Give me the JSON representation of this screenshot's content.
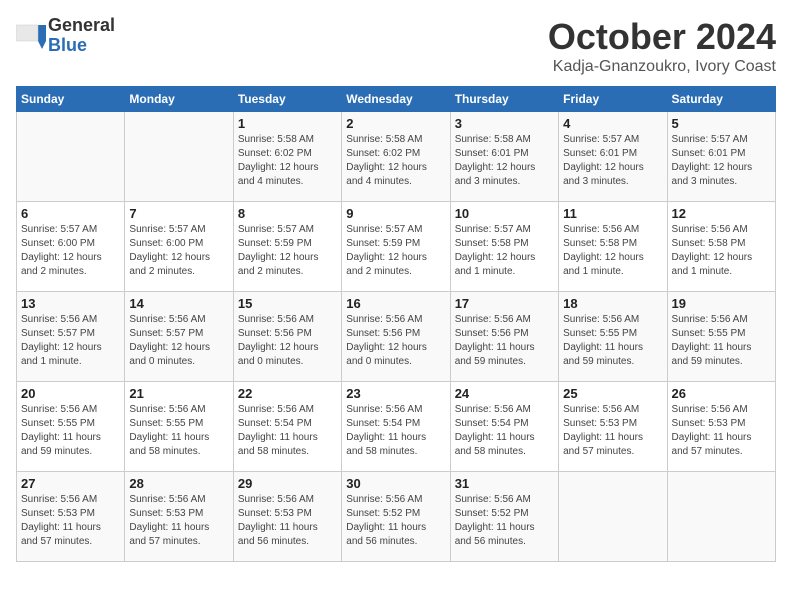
{
  "header": {
    "logo_general": "General",
    "logo_blue": "Blue",
    "month_title": "October 2024",
    "location": "Kadja-Gnanzoukro, Ivory Coast"
  },
  "days_of_week": [
    "Sunday",
    "Monday",
    "Tuesday",
    "Wednesday",
    "Thursday",
    "Friday",
    "Saturday"
  ],
  "weeks": [
    [
      {
        "day": "",
        "info": ""
      },
      {
        "day": "",
        "info": ""
      },
      {
        "day": "1",
        "info": "Sunrise: 5:58 AM\nSunset: 6:02 PM\nDaylight: 12 hours\nand 4 minutes."
      },
      {
        "day": "2",
        "info": "Sunrise: 5:58 AM\nSunset: 6:02 PM\nDaylight: 12 hours\nand 4 minutes."
      },
      {
        "day": "3",
        "info": "Sunrise: 5:58 AM\nSunset: 6:01 PM\nDaylight: 12 hours\nand 3 minutes."
      },
      {
        "day": "4",
        "info": "Sunrise: 5:57 AM\nSunset: 6:01 PM\nDaylight: 12 hours\nand 3 minutes."
      },
      {
        "day": "5",
        "info": "Sunrise: 5:57 AM\nSunset: 6:01 PM\nDaylight: 12 hours\nand 3 minutes."
      }
    ],
    [
      {
        "day": "6",
        "info": "Sunrise: 5:57 AM\nSunset: 6:00 PM\nDaylight: 12 hours\nand 2 minutes."
      },
      {
        "day": "7",
        "info": "Sunrise: 5:57 AM\nSunset: 6:00 PM\nDaylight: 12 hours\nand 2 minutes."
      },
      {
        "day": "8",
        "info": "Sunrise: 5:57 AM\nSunset: 5:59 PM\nDaylight: 12 hours\nand 2 minutes."
      },
      {
        "day": "9",
        "info": "Sunrise: 5:57 AM\nSunset: 5:59 PM\nDaylight: 12 hours\nand 2 minutes."
      },
      {
        "day": "10",
        "info": "Sunrise: 5:57 AM\nSunset: 5:58 PM\nDaylight: 12 hours\nand 1 minute."
      },
      {
        "day": "11",
        "info": "Sunrise: 5:56 AM\nSunset: 5:58 PM\nDaylight: 12 hours\nand 1 minute."
      },
      {
        "day": "12",
        "info": "Sunrise: 5:56 AM\nSunset: 5:58 PM\nDaylight: 12 hours\nand 1 minute."
      }
    ],
    [
      {
        "day": "13",
        "info": "Sunrise: 5:56 AM\nSunset: 5:57 PM\nDaylight: 12 hours\nand 1 minute."
      },
      {
        "day": "14",
        "info": "Sunrise: 5:56 AM\nSunset: 5:57 PM\nDaylight: 12 hours\nand 0 minutes."
      },
      {
        "day": "15",
        "info": "Sunrise: 5:56 AM\nSunset: 5:56 PM\nDaylight: 12 hours\nand 0 minutes."
      },
      {
        "day": "16",
        "info": "Sunrise: 5:56 AM\nSunset: 5:56 PM\nDaylight: 12 hours\nand 0 minutes."
      },
      {
        "day": "17",
        "info": "Sunrise: 5:56 AM\nSunset: 5:56 PM\nDaylight: 11 hours\nand 59 minutes."
      },
      {
        "day": "18",
        "info": "Sunrise: 5:56 AM\nSunset: 5:55 PM\nDaylight: 11 hours\nand 59 minutes."
      },
      {
        "day": "19",
        "info": "Sunrise: 5:56 AM\nSunset: 5:55 PM\nDaylight: 11 hours\nand 59 minutes."
      }
    ],
    [
      {
        "day": "20",
        "info": "Sunrise: 5:56 AM\nSunset: 5:55 PM\nDaylight: 11 hours\nand 59 minutes."
      },
      {
        "day": "21",
        "info": "Sunrise: 5:56 AM\nSunset: 5:55 PM\nDaylight: 11 hours\nand 58 minutes."
      },
      {
        "day": "22",
        "info": "Sunrise: 5:56 AM\nSunset: 5:54 PM\nDaylight: 11 hours\nand 58 minutes."
      },
      {
        "day": "23",
        "info": "Sunrise: 5:56 AM\nSunset: 5:54 PM\nDaylight: 11 hours\nand 58 minutes."
      },
      {
        "day": "24",
        "info": "Sunrise: 5:56 AM\nSunset: 5:54 PM\nDaylight: 11 hours\nand 58 minutes."
      },
      {
        "day": "25",
        "info": "Sunrise: 5:56 AM\nSunset: 5:53 PM\nDaylight: 11 hours\nand 57 minutes."
      },
      {
        "day": "26",
        "info": "Sunrise: 5:56 AM\nSunset: 5:53 PM\nDaylight: 11 hours\nand 57 minutes."
      }
    ],
    [
      {
        "day": "27",
        "info": "Sunrise: 5:56 AM\nSunset: 5:53 PM\nDaylight: 11 hours\nand 57 minutes."
      },
      {
        "day": "28",
        "info": "Sunrise: 5:56 AM\nSunset: 5:53 PM\nDaylight: 11 hours\nand 57 minutes."
      },
      {
        "day": "29",
        "info": "Sunrise: 5:56 AM\nSunset: 5:53 PM\nDaylight: 11 hours\nand 56 minutes."
      },
      {
        "day": "30",
        "info": "Sunrise: 5:56 AM\nSunset: 5:52 PM\nDaylight: 11 hours\nand 56 minutes."
      },
      {
        "day": "31",
        "info": "Sunrise: 5:56 AM\nSunset: 5:52 PM\nDaylight: 11 hours\nand 56 minutes."
      },
      {
        "day": "",
        "info": ""
      },
      {
        "day": "",
        "info": ""
      }
    ]
  ]
}
